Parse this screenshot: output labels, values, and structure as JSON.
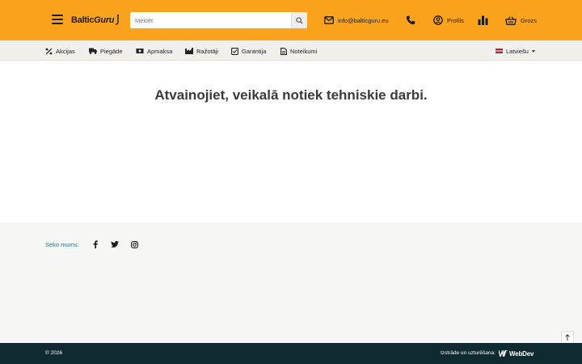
{
  "header": {
    "logo": {
      "part1": "Baltic",
      "part2": "Guru"
    },
    "search": {
      "placeholder": "Meklēt",
      "value": ""
    },
    "email": "info@balticguru.eu",
    "profile_label": "Profils",
    "cart_label": "Grozs"
  },
  "nav": {
    "items": [
      {
        "label": "Akcijas",
        "icon": "percent-icon"
      },
      {
        "label": "Piegāde",
        "icon": "truck-icon"
      },
      {
        "label": "Apmaksa",
        "icon": "money-icon"
      },
      {
        "label": "Ražotāji",
        "icon": "factory-icon"
      },
      {
        "label": "Garantija",
        "icon": "check-square-icon"
      },
      {
        "label": "Noteikumi",
        "icon": "document-icon"
      }
    ],
    "language": "Latviešu"
  },
  "main": {
    "message": "Atvainojiet, veikalā notiek tehniskie darbi."
  },
  "footer": {
    "follow_label": "Seko mums:",
    "social": [
      "facebook-icon",
      "twitter-icon",
      "instagram-icon"
    ],
    "copyright": "© 2026",
    "developer_label": "Izstrāde un uzturēšana:",
    "developer_name": "WebDev"
  },
  "colors": {
    "header_bg": "#fba31c",
    "nav_bg": "#f1f0ed",
    "footer_bg": "#f7f7f5",
    "bottom_bar_bg": "#0f2a30",
    "link_blue": "#2a6f8f"
  }
}
